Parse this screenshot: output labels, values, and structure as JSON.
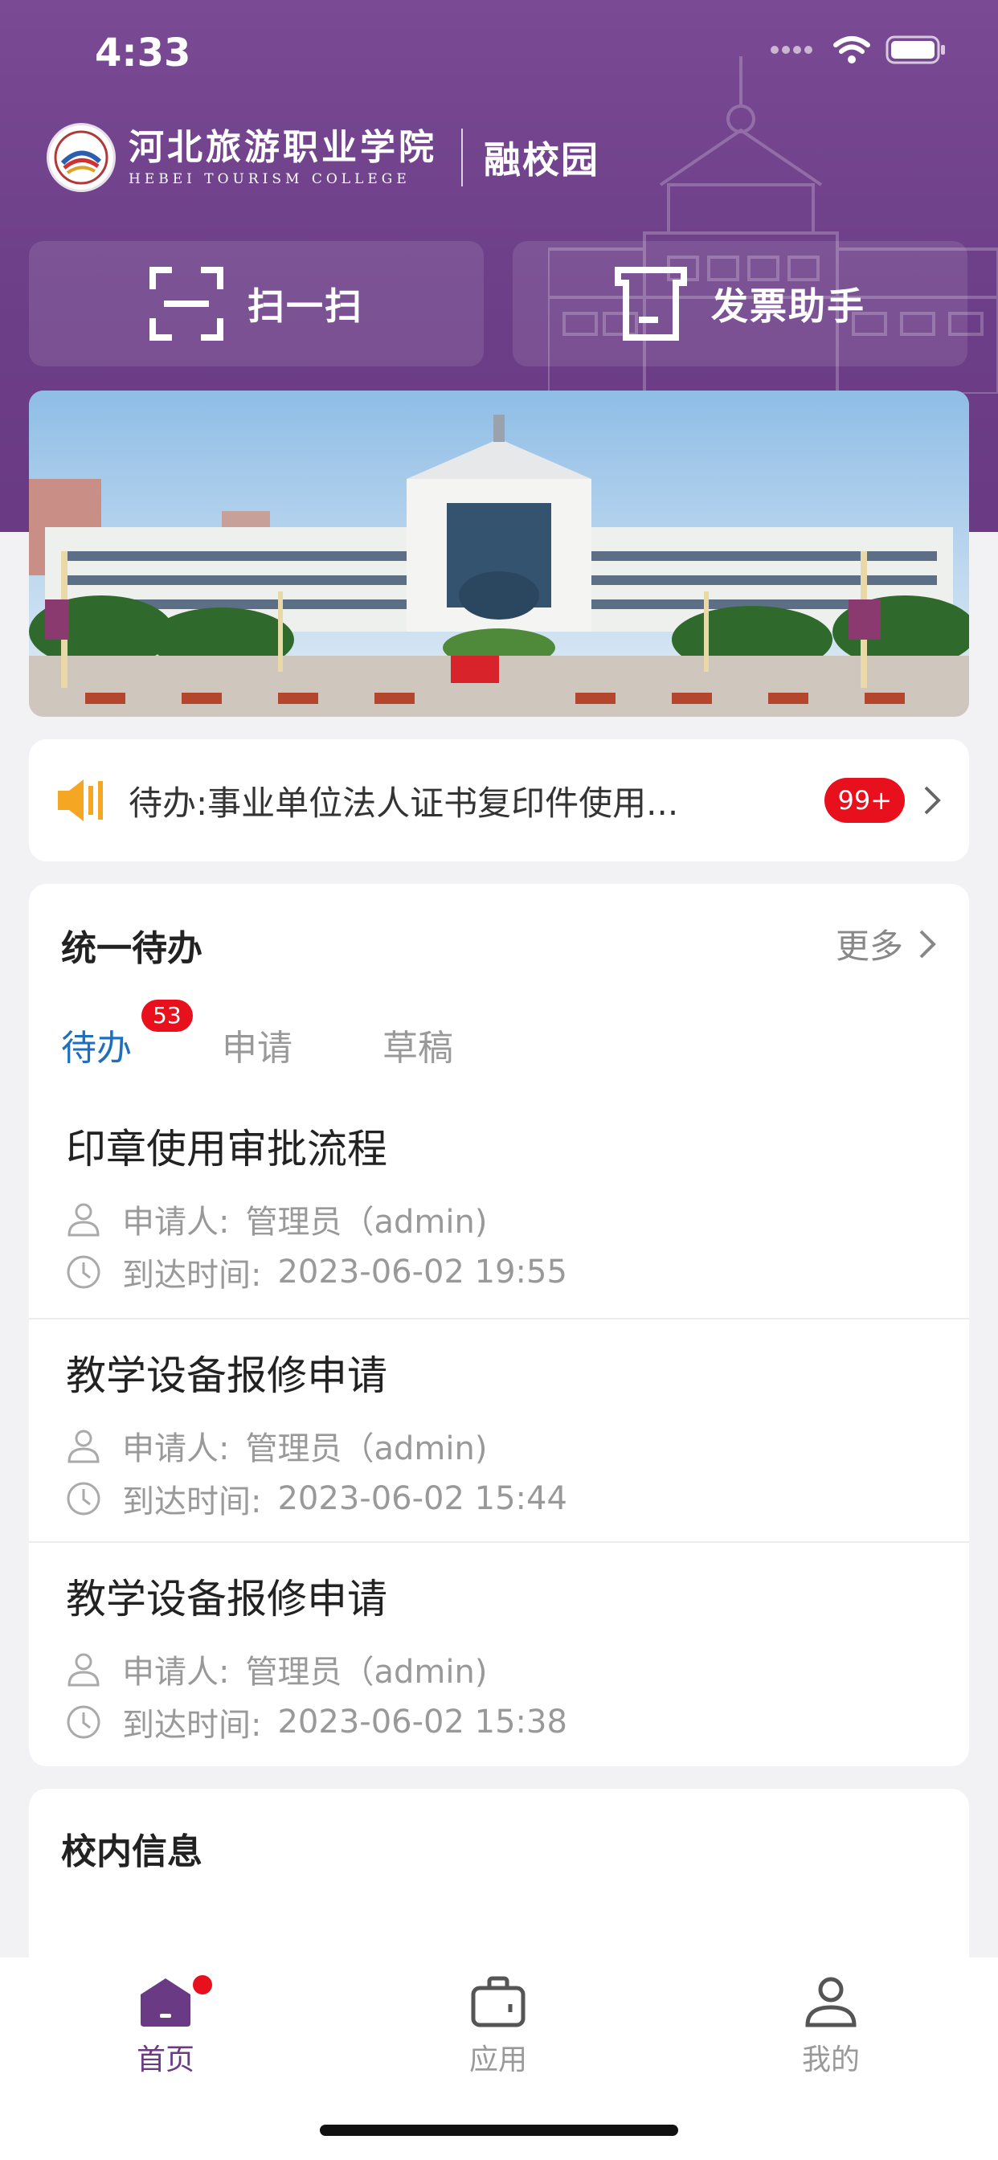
{
  "status_bar": {
    "time": "4:33"
  },
  "header": {
    "school_name_cn": "河北旅游职业学院",
    "school_name_en": "HEBEI TOURISM COLLEGE",
    "brand": "融校园",
    "accent_color": "#6d3f88"
  },
  "quick_actions": [
    {
      "label": "扫一扫",
      "icon": "scan-icon"
    },
    {
      "label": "发票助手",
      "icon": "invoice-icon"
    }
  ],
  "banner": {
    "alt": "campus-building-photo"
  },
  "notice": {
    "text": "待办:事业单位法人证书复印件使用...",
    "badge": "99+",
    "icon": "speaker-icon"
  },
  "todo": {
    "title": "统一待办",
    "more_label": "更多",
    "tabs": [
      {
        "label": "待办",
        "badge": "53",
        "active": true
      },
      {
        "label": "申请",
        "active": false
      },
      {
        "label": "草稿",
        "active": false
      }
    ],
    "applicant_label": "申请人:",
    "arrival_label": "到达时间:",
    "items": [
      {
        "title": "印章使用审批流程",
        "applicant": "管理员（admin)",
        "time": "2023-06-02 19:55"
      },
      {
        "title": "教学设备报修申请",
        "applicant": "管理员（admin)",
        "time": "2023-06-02 15:44"
      },
      {
        "title": "教学设备报修申请",
        "applicant": "管理员（admin)",
        "time": "2023-06-02 15:38"
      }
    ]
  },
  "campus_info": {
    "title": "校内信息"
  },
  "tabbar": {
    "items": [
      {
        "label": "首页",
        "icon": "home-icon",
        "active": true
      },
      {
        "label": "应用",
        "icon": "briefcase-icon",
        "active": false
      },
      {
        "label": "我的",
        "icon": "person-icon",
        "active": false
      }
    ],
    "active_color": "#6a3a84"
  }
}
